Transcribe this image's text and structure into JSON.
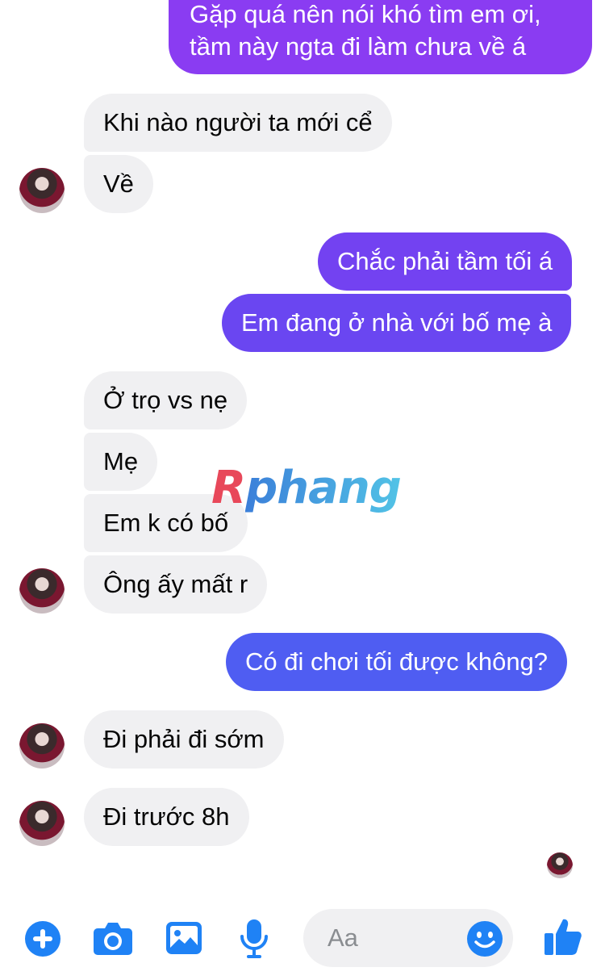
{
  "colors": {
    "incoming_bubble": "#f0f0f2",
    "outgoing_purple": "#7b3ff2",
    "outgoing_blue": "#4f5df2",
    "accent": "#1f82f5",
    "watermark_red": "#e8485a",
    "watermark_blue": "#3b7fd9"
  },
  "messages": [
    {
      "from": "me",
      "text": "Gặp quá nên nói khó tìm em ơi,\ntầm này ngta đi làm chưa về á"
    },
    {
      "from": "them",
      "text": "Khi nào người ta mới cể"
    },
    {
      "from": "them",
      "text": "Về"
    },
    {
      "from": "me",
      "text": "Chắc phải tầm tối á"
    },
    {
      "from": "me",
      "text": "Em đang ở nhà với bố mẹ à"
    },
    {
      "from": "them",
      "text": "Ở trọ vs nẹ"
    },
    {
      "from": "them",
      "text": "Mẹ"
    },
    {
      "from": "them",
      "text": "Em k có bố"
    },
    {
      "from": "them",
      "text": "Ông ấy mất r"
    },
    {
      "from": "me",
      "text": "Có đi chơi tối được không?"
    },
    {
      "from": "them",
      "text": "Đi phải đi sớm"
    },
    {
      "from": "them",
      "text": "Đi trước 8h"
    }
  ],
  "watermark": {
    "first": "R",
    "rest": "phang"
  },
  "composer": {
    "placeholder": "Aa",
    "icons": [
      "plus-icon",
      "camera-icon",
      "image-icon",
      "microphone-icon",
      "emoji-icon",
      "thumbs-up-icon"
    ]
  }
}
